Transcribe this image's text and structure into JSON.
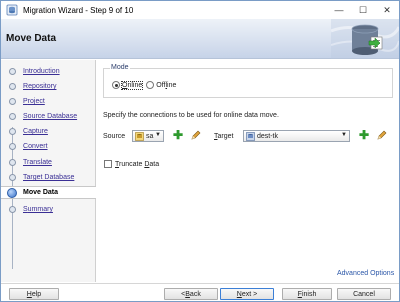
{
  "window": {
    "title": "Migration Wizard - Step 9 of 10",
    "minimize_glyph": "—",
    "maximize_glyph": "☐",
    "close_glyph": "✕"
  },
  "header": {
    "title": "Move Data"
  },
  "steps": [
    {
      "label_u": "I",
      "label_rest": "ntroduction"
    },
    {
      "label_u": "R",
      "label_rest": "epository"
    },
    {
      "label_u": "P",
      "label_rest": "roject"
    },
    {
      "label_u": "S",
      "label_rest": "ource Database"
    },
    {
      "label_u": "C",
      "label_rest": "apture"
    },
    {
      "label_u": "C",
      "label_rest": "onvert"
    },
    {
      "label_u": "T",
      "label_rest": "ranslate"
    },
    {
      "label_u": "T",
      "label_rest": "arget Database"
    },
    {
      "label_u": "",
      "label_rest": "Move Data"
    },
    {
      "label_u": "S",
      "label_rest": "ummary"
    }
  ],
  "mode": {
    "legend": "Mode",
    "online_u": "O",
    "online_rest": "nline",
    "offline_pre": "Off",
    "offline_u": "l",
    "offline_rest": "ine",
    "selected": "online"
  },
  "connections": {
    "instruction": "Specify the connections to be used for online data move.",
    "source_label": "Source",
    "source_value": "sa",
    "target_label_u": "T",
    "target_label_rest": "arget",
    "target_value": "dest-tk",
    "add_glyph": "✚"
  },
  "truncate": {
    "label_u": "T",
    "label_pre": "runcate ",
    "label_u2": "D",
    "label_rest": "ata",
    "checked": false
  },
  "advanced_link": "Advanced Options",
  "footer": {
    "help_u": "H",
    "help_rest": "elp",
    "back_pre": "< ",
    "back_u": "B",
    "back_rest": "ack",
    "next_u": "N",
    "next_rest": "ext >",
    "finish_u": "F",
    "finish_rest": "inish",
    "cancel": "Cancel"
  },
  "colors": {
    "link": "#3a2f95",
    "header_gradient_top": "#eef2f8",
    "header_gradient_bottom": "#c6d3e8",
    "add_green": "#2e9a2e"
  }
}
